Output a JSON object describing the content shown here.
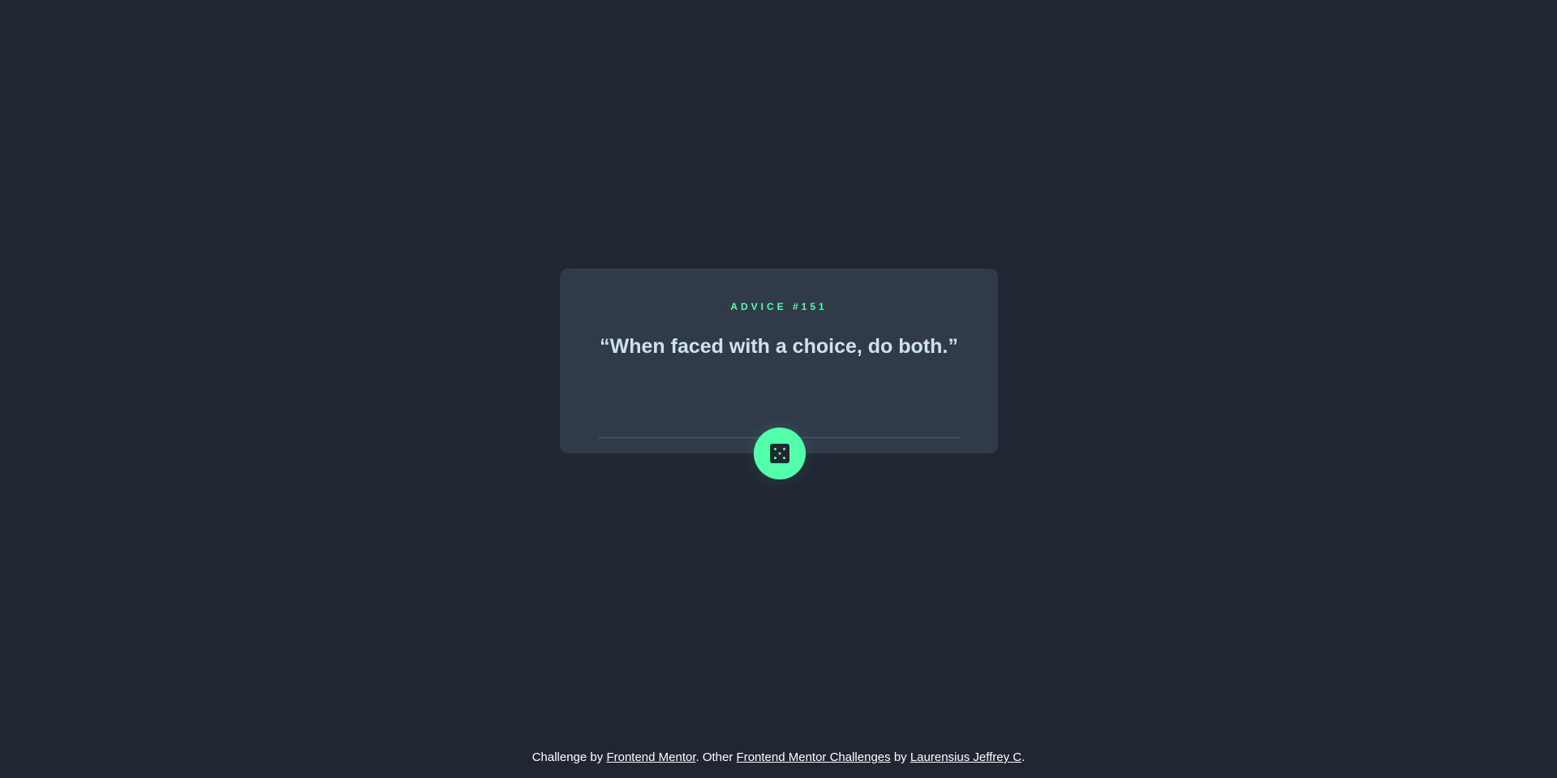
{
  "advice": {
    "id_label": "ADVICE #151",
    "quote": "“When faced with a choice, do both.”"
  },
  "dice_button": {
    "icon": "dice-icon"
  },
  "footer": {
    "prefix": "Challenge by",
    "frontend_mentor_link": "Frontend Mentor",
    "middle": ". Other",
    "challenges_link": "Frontend Mentor Challenges",
    "by": "by",
    "author_link": "Laurensius Jeffrey C",
    "suffix": "."
  },
  "colors": {
    "background": "#202733",
    "card": "#313a49",
    "accent": "#53ffaa",
    "quote_text": "#cee3e9",
    "divider": "#4f5b6e"
  }
}
